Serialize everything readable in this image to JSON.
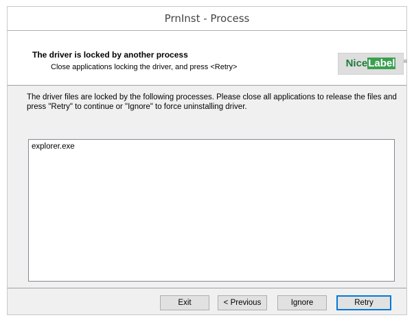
{
  "window": {
    "title": "PrnInst - Process"
  },
  "header": {
    "title": "The driver is locked by another process",
    "subtitle": "Close applications locking the driver, and press <Retry>",
    "logo_part1": "Nice",
    "logo_part2": "Label",
    "logo_reg": "®"
  },
  "message": {
    "text": "The driver files are locked by the following processes. Please close all applications to release the files and press \"Retry\" to continue or \"Ignore\" to force uninstalling driver."
  },
  "process_list": {
    "items": [
      "explorer.exe"
    ]
  },
  "buttons": {
    "exit_label": "Exit",
    "previous_label": "< Previous",
    "ignore_label": "Ignore",
    "retry_label": "Retry"
  },
  "colors": {
    "logo_green": "#3aa050",
    "default_button_border": "#0078d7"
  }
}
